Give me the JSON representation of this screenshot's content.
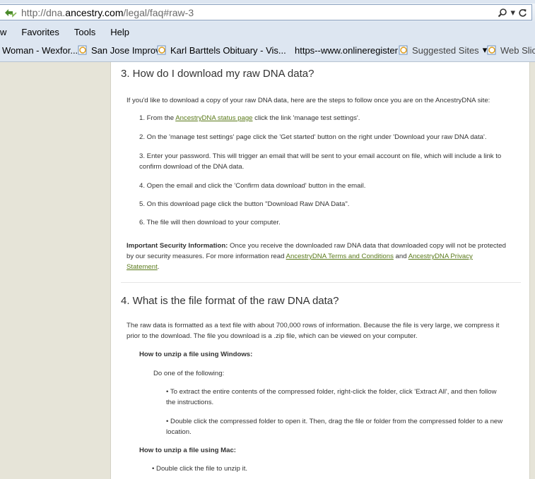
{
  "browser": {
    "url_prefix": "http://dna.",
    "url_domain": "ancestry.com",
    "url_suffix": "/legal/faq#raw-3",
    "search_glyph": "ρ",
    "dropdown_glyph": "▾",
    "refresh_glyph": "c"
  },
  "menu": {
    "view": "w",
    "favorites": "Favorites",
    "tools": "Tools",
    "help": "Help"
  },
  "favorites": {
    "item1": "Woman - Wexfor...",
    "item2": "San Jose Improv",
    "item3": "Karl Barttels Obituary - Vis...",
    "item4": "https--www.onlineregister",
    "item5": "Suggested Sites",
    "item5_arrow": "▾",
    "item6": "Web Slice"
  },
  "faq3": {
    "heading": "3. How do I download my raw DNA data?",
    "intro": "If you'd like to download a copy of your raw DNA data, here are the steps to follow once you are on the AncestryDNA site:",
    "step1_pre": "1. From the ",
    "step1_link": "AncestryDNA status page",
    "step1_post": " click the link 'manage test settings'.",
    "step2": "2. On the 'manage test settings' page click the 'Get started' button on the right under 'Download your raw DNA data'.",
    "step3_l1": "3. Enter your password. This will trigger an email that will be sent to your email account on file, which will include a link to",
    "step3_l2": "confirm download of the DNA data.",
    "step4": "4. Open the email and click the 'Confirm data download' button in the email.",
    "step5": "5. On this download page click the button \"Download Raw DNA Data\".",
    "step6": "6. The file will then download to your computer.",
    "security_bold": "Important Security Information:",
    "security_l1": " Once you receive the downloaded raw DNA data that downloaded copy will not be protected",
    "security_l2_pre": "by our security measures. For more information read ",
    "terms_link": "AncestryDNA Terms and Conditions",
    "and": " and ",
    "privacy_link_l2": "AncestryDNA Privacy",
    "privacy_link_l3": "Statement",
    "period": "."
  },
  "faq4": {
    "heading": "4. What is the file format of the raw DNA data?",
    "intro_l1": "The raw data is formatted as a text file with about 700,000 rows of information. Because the file is very large, we compress it",
    "intro_l2": "prior to the download. The file you download is a .zip file, which can be viewed on your computer.",
    "windows_heading": "How to unzip a file using Windows:",
    "windows_do_one": "Do one of the following:",
    "win_opt1_l1": "• To extract the entire contents of the compressed folder, right-click the folder, click 'Extract All', and then follow",
    "win_opt1_l2": "the instructions.",
    "win_opt2_l1": "• Double click the compressed folder to open it. Then, drag the file or folder from the compressed folder to a new",
    "win_opt2_l2": "location.",
    "mac_heading": "How to unzip a file using Mac:",
    "mac_opt1": "• Double click the file to unzip it."
  }
}
